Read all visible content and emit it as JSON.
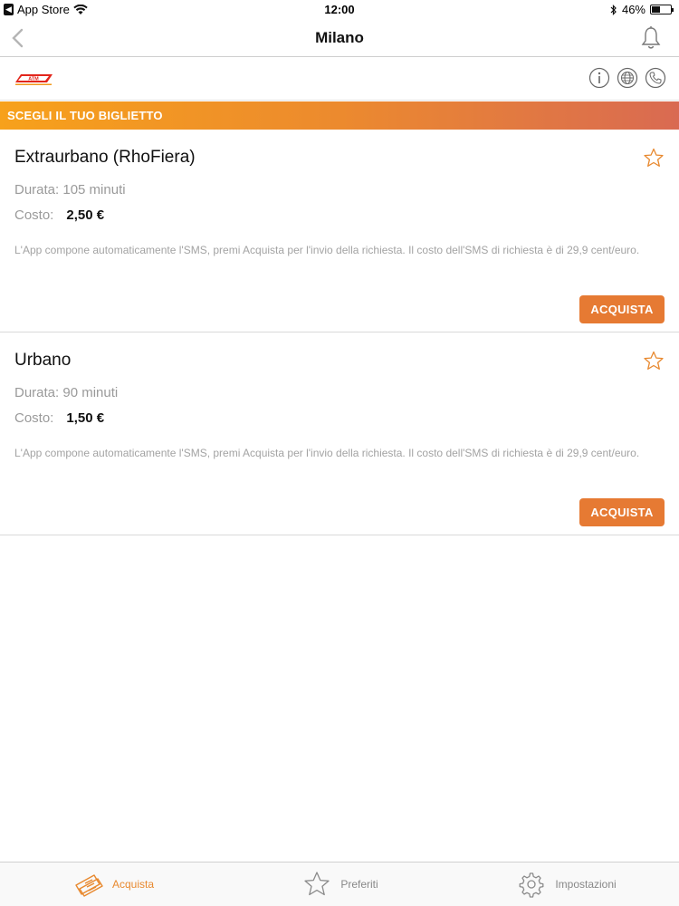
{
  "status_bar": {
    "back_app": "App Store",
    "time": "12:00",
    "battery": "46%",
    "battery_level": 0.46
  },
  "nav": {
    "title": "Milano"
  },
  "header": {
    "logo_text": "ATM"
  },
  "banner": {
    "label": "SCEGLI IL TUO BIGLIETTO"
  },
  "tickets": [
    {
      "title": "Extraurbano (RhoFiera)",
      "duration": "Durata: 105 minuti",
      "cost_label": "Costo:",
      "cost_value": "2,50 €",
      "note": "L'App compone automaticamente l'SMS, premi Acquista per l'invio della richiesta. Il costo dell'SMS di richiesta è di 29,9 cent/euro.",
      "button": "ACQUISTA"
    },
    {
      "title": "Urbano",
      "duration": "Durata: 90 minuti",
      "cost_label": "Costo:",
      "cost_value": "1,50 €",
      "note": "L'App compone automaticamente l'SMS, premi Acquista per l'invio della richiesta. Il costo dell'SMS di richiesta è di 29,9 cent/euro.",
      "button": "ACQUISTA"
    }
  ],
  "tabs": [
    {
      "label": "Acquista",
      "icon": "tickets-icon",
      "active": true
    },
    {
      "label": "Preferiti",
      "icon": "star-icon",
      "active": false
    },
    {
      "label": "Impostazioni",
      "icon": "gear-icon",
      "active": false
    }
  ],
  "colors": {
    "accent": "#e67a33",
    "banner_start": "#f7a11b",
    "banner_end": "#d96a52"
  }
}
